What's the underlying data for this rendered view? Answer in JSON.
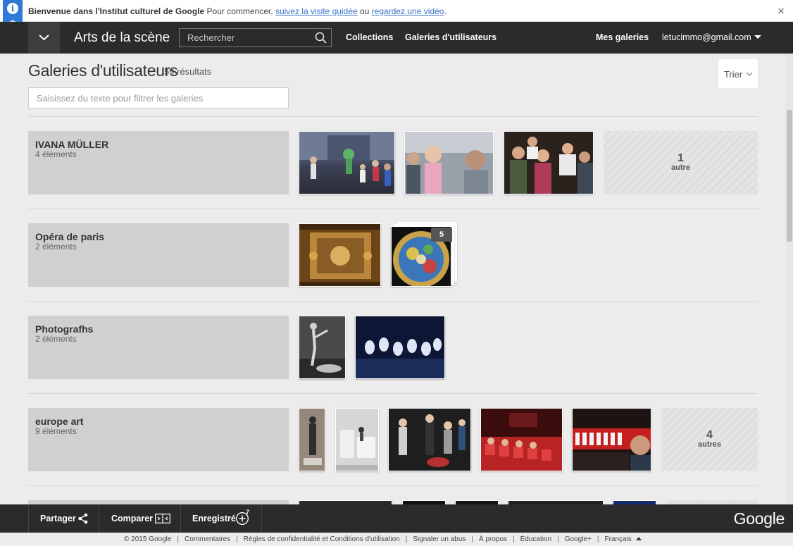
{
  "banner": {
    "bold": "Bienvenue dans l'Institut culturel de Google",
    "text": " Pour commencer, ",
    "link1": "suivez la visite guidée",
    "middle": " ou ",
    "link2": "regardez une vidéo",
    "end": ".",
    "close": "×"
  },
  "nav": {
    "title": "Arts de la scène",
    "search_placeholder": "Rechercher",
    "collections": "Collections",
    "user_galleries": "Galeries d'utilisateurs",
    "my_galleries": "Mes galeries",
    "user_email": "letucimmo@gmail.com"
  },
  "page": {
    "title": "Galeries d'utilisateurs",
    "result_count": "59 résultats",
    "sort_label": "Trier",
    "filter_placeholder": "Saisissez du texte pour filtrer les galeries"
  },
  "galleries": [
    {
      "name": "IVANA MÜLLER",
      "count": "4 éléments",
      "more_num": "1",
      "more_word": "autre"
    },
    {
      "name": "Opéra de paris",
      "count": "2 éléments",
      "stack_count": "5"
    },
    {
      "name": "Photografhs",
      "count": "2 éléments"
    },
    {
      "name": "europe art",
      "count": "9 éléments",
      "more_num": "4",
      "more_word": "autres"
    }
  ],
  "bottombar": {
    "share": "Partager",
    "compare": "Comparer",
    "saved": "Enregistré",
    "saved_count": "7",
    "logo": "Google"
  },
  "footer": {
    "items": [
      "© 2015 Google",
      "Commentaires",
      "Règles de confidentialité et Conditions d'utilisation",
      "Signaler un abus",
      "À propos",
      "Éducation",
      "Google+",
      "Français"
    ]
  },
  "colors": {
    "nav_bg": "#2b2b2b",
    "link_blue": "#3a73c8",
    "banner_icon": "#2e7ad6",
    "card_bg": "#d0d0d0"
  }
}
